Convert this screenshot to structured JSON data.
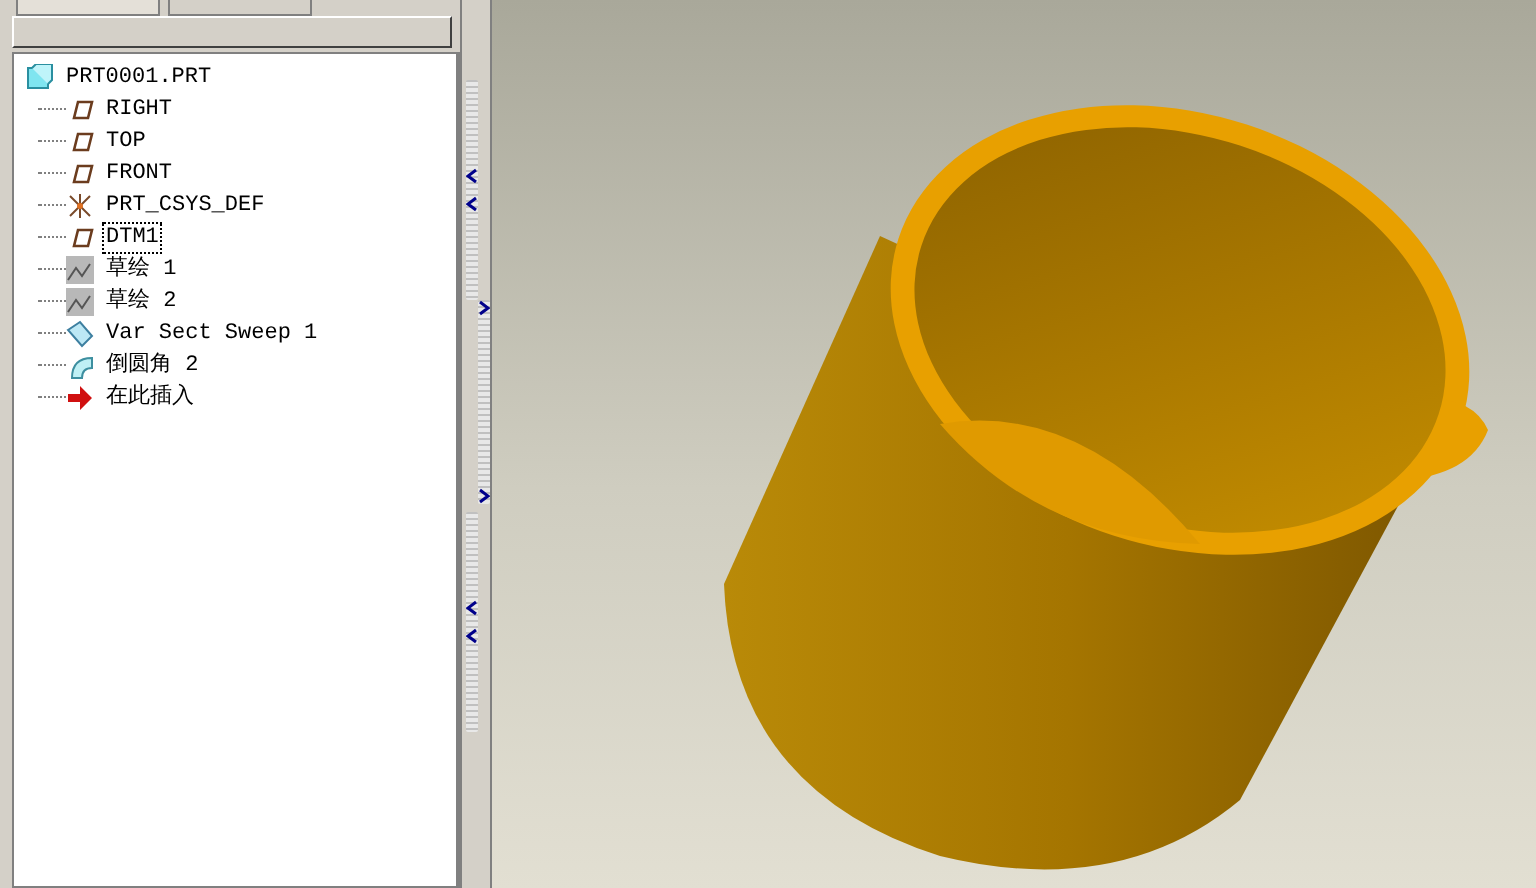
{
  "model_tree": {
    "root": {
      "label": "PRT0001.PRT",
      "kind": "part",
      "children": [
        {
          "label": "RIGHT",
          "kind": "plane",
          "selected": false
        },
        {
          "label": "TOP",
          "kind": "plane",
          "selected": false
        },
        {
          "label": "FRONT",
          "kind": "plane",
          "selected": false
        },
        {
          "label": "PRT_CSYS_DEF",
          "kind": "csys",
          "selected": false
        },
        {
          "label": "DTM1",
          "kind": "plane",
          "selected": true
        },
        {
          "label": "草绘 1",
          "kind": "sketch",
          "selected": false
        },
        {
          "label": "草绘 2",
          "kind": "sketch",
          "selected": false
        },
        {
          "label": "Var Sect Sweep 1",
          "kind": "sweep",
          "selected": false
        },
        {
          "label": "倒圆角 2",
          "kind": "round",
          "selected": false
        },
        {
          "label": "在此插入",
          "kind": "insert",
          "selected": false
        }
      ]
    }
  }
}
